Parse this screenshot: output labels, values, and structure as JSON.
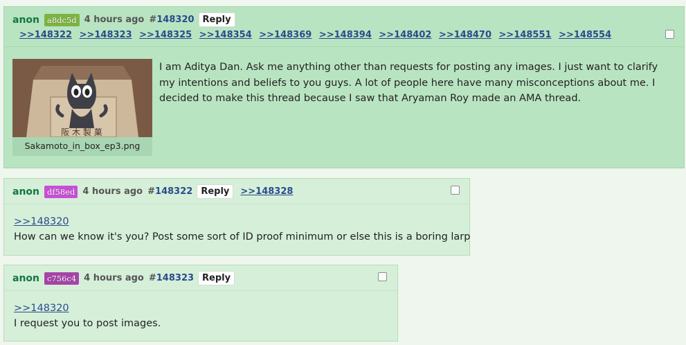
{
  "op": {
    "name": "anon",
    "id": "a8dc5d",
    "id_color": "#7cb342",
    "time": "4 hours ago",
    "hash": "#",
    "number": "148320",
    "reply_label": "Reply",
    "backlinks": [
      ">>148322",
      ">>148323",
      ">>148325",
      ">>148354",
      ">>148369",
      ">>148394",
      ">>148402",
      ">>148470",
      ">>148551",
      ">>148554"
    ],
    "image_filename": "Sakamoto_in_box_ep3.png",
    "text": "I am Aditya Dan. Ask me anything other than requests for posting any images. I just want to clarify my intentions and beliefs to you guys. A lot of people here have many misconceptions about me. I decided to make this thread because I saw that Aryaman Roy made an AMA thread."
  },
  "replies": [
    {
      "name": "anon",
      "id": "df58ed",
      "id_color": "#c94fd6",
      "time": "4 hours ago",
      "hash": "#",
      "number": "148322",
      "reply_label": "Reply",
      "backlink": ">>148328",
      "quote": ">>148320",
      "text": "How can we know it's you? Post some sort of ID proof minimum or else this is a boring larp"
    },
    {
      "name": "anon",
      "id": "c756c4",
      "id_color": "#a544a8",
      "time": "4 hours ago",
      "hash": "#",
      "number": "148323",
      "reply_label": "Reply",
      "quote": ">>148320",
      "text": "I request you to post images."
    }
  ]
}
